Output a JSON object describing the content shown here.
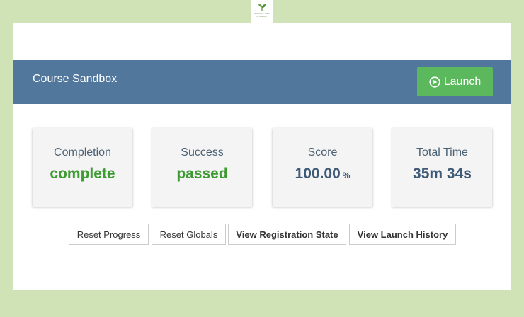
{
  "logo": {
    "icon": "leaf-icon",
    "text_line1": "SCIENCE AND",
    "text_line2": "LITERACY"
  },
  "header": {
    "title": "Course Sandbox",
    "launch_label": "Launch",
    "launch_icon": "play-circle-icon"
  },
  "stats": {
    "completion": {
      "label": "Completion",
      "value": "complete"
    },
    "success": {
      "label": "Success",
      "value": "passed"
    },
    "score": {
      "label": "Score",
      "value": "100.00",
      "unit": "%"
    },
    "total_time": {
      "label": "Total Time",
      "value": "35m 34s"
    }
  },
  "actions": {
    "reset_progress": "Reset Progress",
    "reset_globals": "Reset Globals",
    "view_registration_state": "View Registration State",
    "view_launch_history": "View Launch History"
  },
  "colors": {
    "page_background": "#cfe3b6",
    "header_background": "#52779c",
    "launch_button": "#5cb85c",
    "status_green": "#3e9b34",
    "value_blue": "#3e5a77"
  }
}
